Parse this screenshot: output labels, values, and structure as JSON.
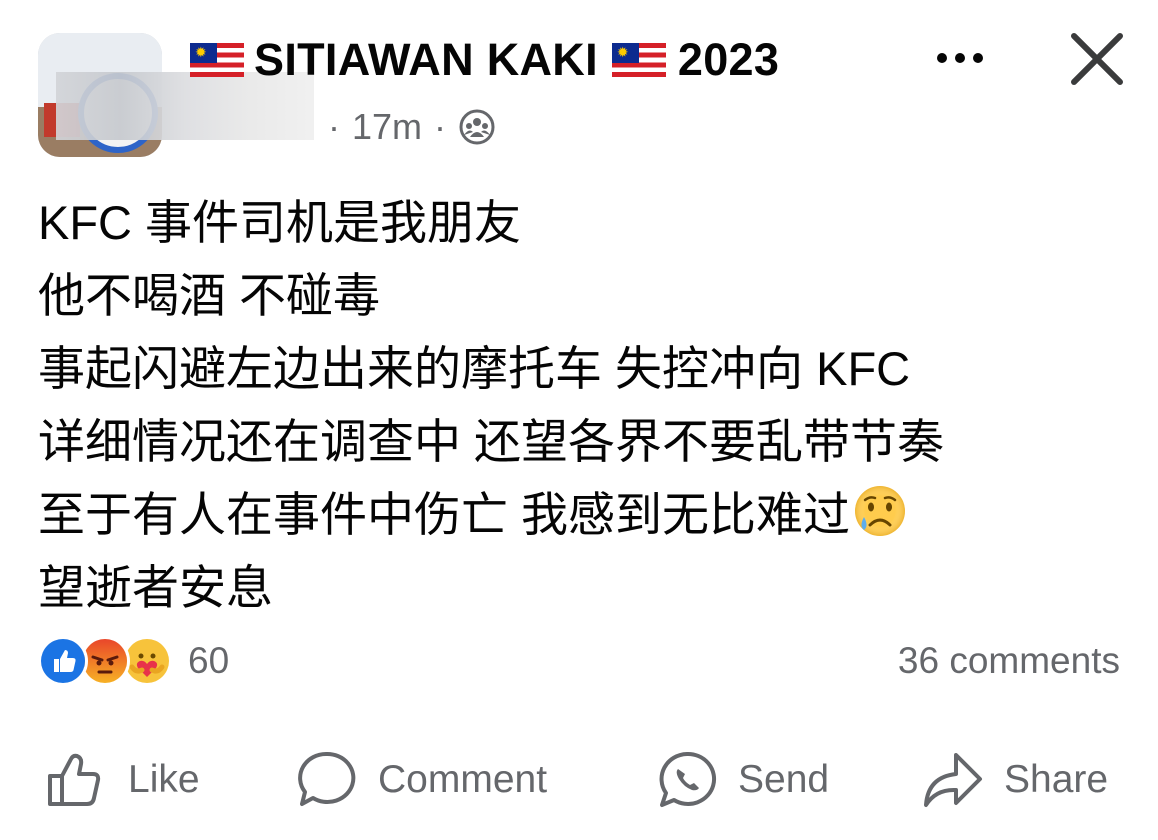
{
  "header": {
    "group_name_left": "SITIAWAN KAKI",
    "group_name_right": "2023",
    "time_ago": "17m",
    "dot": "·",
    "audience_icon": "group-audience-icon",
    "more_icon": "more-dots-icon",
    "close_icon": "close-icon"
  },
  "post": {
    "lines": [
      "KFC 事件司机是我朋友",
      "他不喝酒 不碰毒",
      "事起闪避左边出来的摩托车 失控冲向 KFC",
      "详细情况还在调查中 还望各界不要乱带节奏",
      "至于有人在事件中伤亡 我感到无比难过",
      "望逝者安息"
    ],
    "emoji": "sad-tear-emoji"
  },
  "engagement": {
    "reactions": [
      "like",
      "angry",
      "care"
    ],
    "reaction_count": "60",
    "comments_label": "36 comments"
  },
  "actions": {
    "like": "Like",
    "comment": "Comment",
    "send": "Send",
    "share": "Share"
  },
  "colors": {
    "text": "#050505",
    "secondary": "#65676b",
    "like_blue": "#1b74e4",
    "angry_orange": "#f0652e"
  }
}
